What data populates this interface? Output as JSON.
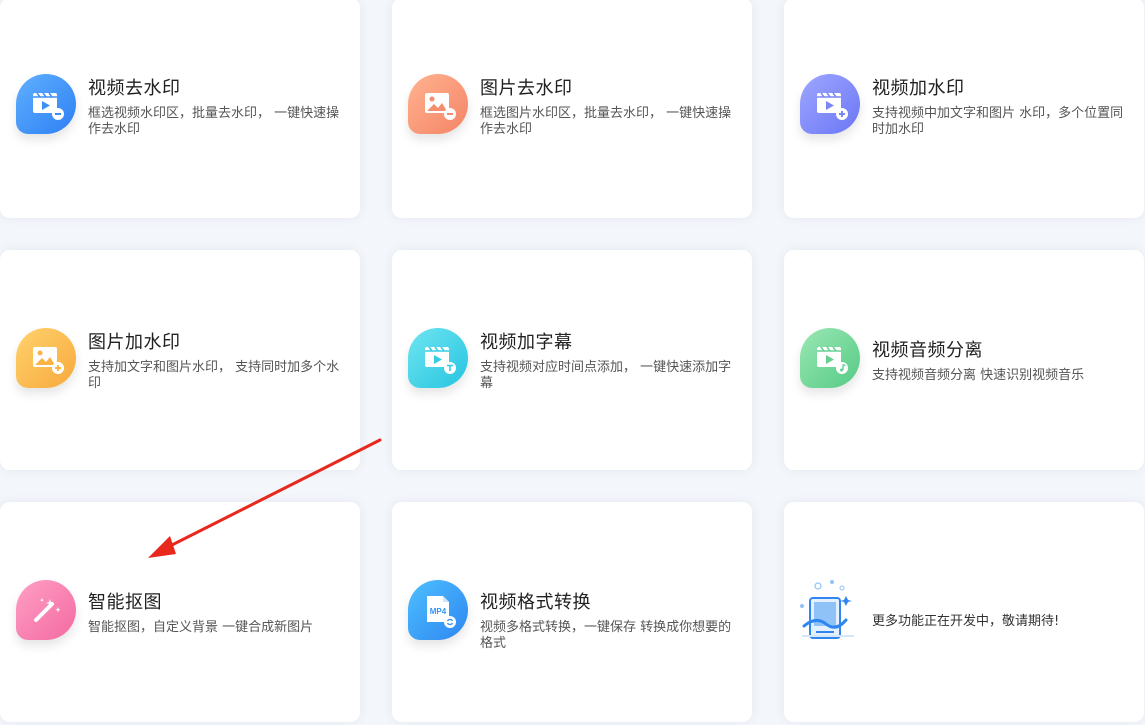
{
  "cards": [
    {
      "title": "视频去水印",
      "desc": "框选视频水印区，批量去水印， 一键快速操作去水印",
      "icon": "video-remove-watermark-icon",
      "color": "#3d8ff7"
    },
    {
      "title": "图片去水印",
      "desc": "框选图片水印区，批量去水印， 一键快速操作去水印",
      "icon": "image-remove-watermark-icon",
      "color": "#f68d6e"
    },
    {
      "title": "视频加水印",
      "desc": "支持视频中加文字和图片 水印，多个位置同时加水印",
      "icon": "video-add-watermark-icon",
      "color": "#7c86f7"
    },
    {
      "title": "图片加水印",
      "desc": "支持加文字和图片水印， 支持同时加多个水印",
      "icon": "image-add-watermark-icon",
      "color": "#f8b445"
    },
    {
      "title": "视频加字幕",
      "desc": "支持视频对应时间点添加， 一键快速添加字幕",
      "icon": "video-subtitle-icon",
      "color": "#35cde5"
    },
    {
      "title": "视频音频分离",
      "desc": "支持视频音频分离 快速识别视频音乐",
      "icon": "video-audio-separate-icon",
      "color": "#66d092"
    },
    {
      "title": "智能抠图",
      "desc": "智能抠图，自定义背景 一键合成新图片",
      "icon": "magic-wand-icon",
      "color": "#f576a8"
    },
    {
      "title": "视频格式转换",
      "desc": "视频多格式转换，一键保存 转换成你想要的格式",
      "icon": "mp4-convert-icon",
      "color": "#3395f3",
      "icon_label": "MP4"
    }
  ],
  "more": {
    "text": "更多功能正在开发中，敬请期待!",
    "icon": "coming-soon-illustration"
  },
  "annotation": {
    "icon": "red-arrow-annotation",
    "color": "#e8281c"
  }
}
